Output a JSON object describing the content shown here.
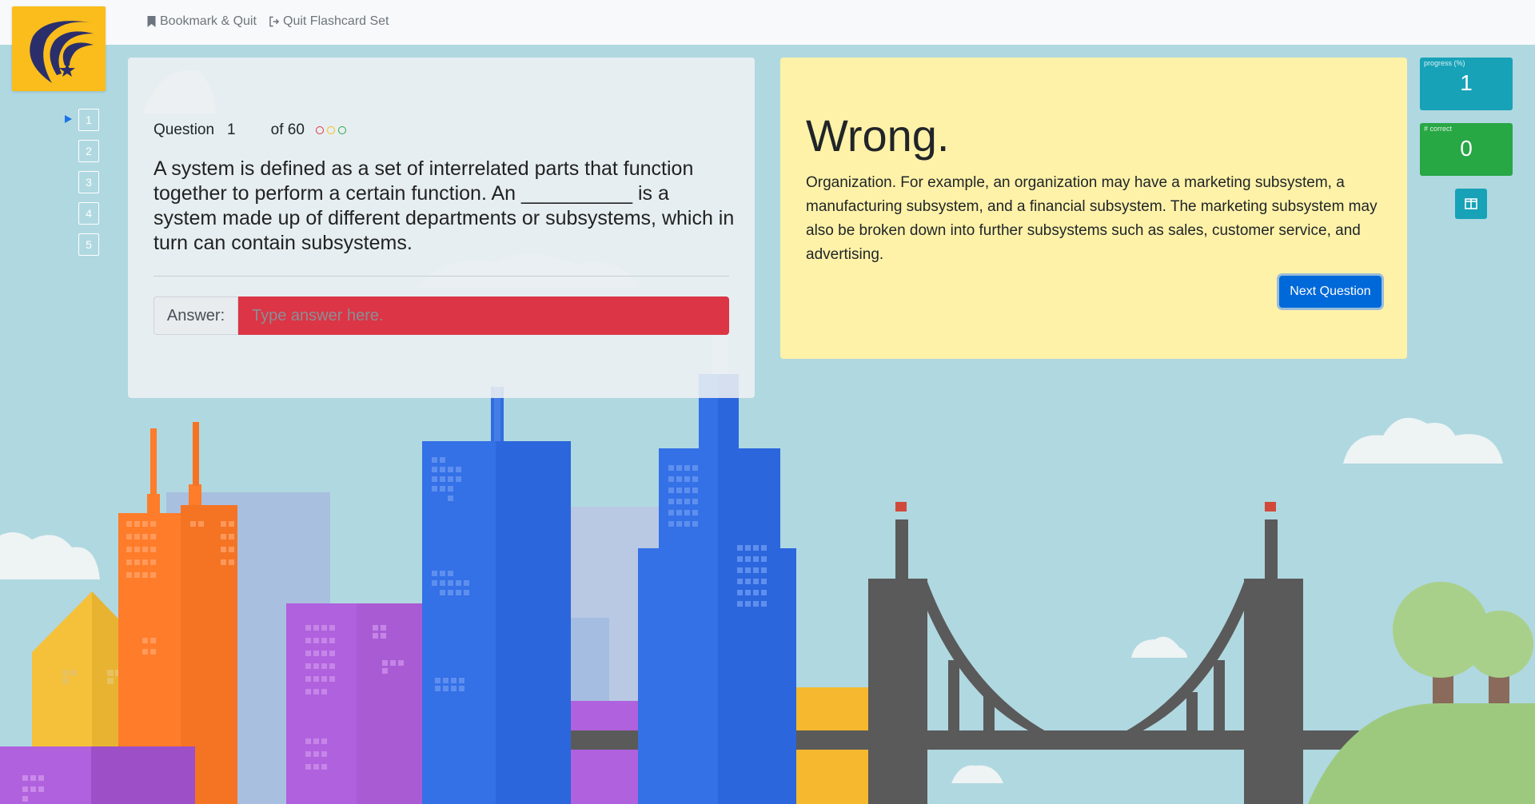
{
  "nav": {
    "bookmark_label": "Bookmark & Quit",
    "quit_label": "Quit Flashcard Set"
  },
  "pager": {
    "items": [
      "1",
      "2",
      "3",
      "4",
      "5"
    ],
    "current_index": 0
  },
  "question": {
    "label": "Question",
    "number": "1",
    "of_total": "of 60",
    "text": "A system is defined as a set of interrelated parts that function together to perform a certain function. An __________ is a system made up of different departments or subsystems, which in turn can contain subsystems.",
    "dot_colors": [
      "#dc3545",
      "#fbbd1c",
      "#28a745"
    ]
  },
  "answer": {
    "label": "Answer:",
    "value": "",
    "placeholder": "Type answer here."
  },
  "feedback": {
    "title": "Wrong.",
    "text": "Organization. For example, an organization may have a marketing subsystem, a manufacturing subsystem, and a financial subsystem. The marketing subsystem may also be broken down into further subsystems such as sales, customer service, and advertising.",
    "next_label": "Next Question"
  },
  "stats": {
    "progress": {
      "label": "progress (%)",
      "value": "1",
      "color": "#17a2b8"
    },
    "correct": {
      "label": "# correct",
      "value": "0",
      "color": "#28a745"
    }
  },
  "colors": {
    "logo_bg": "#fbbd1c",
    "logo_mark": "#2a2f6b",
    "danger": "#dc3545",
    "primary": "#0069d9",
    "feedback_bg": "#fef2a8",
    "sky": "#b0d8e0"
  },
  "icons": {
    "bookmark": "bookmark-icon",
    "quit": "sign-out-icon",
    "layout": "columns-icon",
    "pager_marker": "caret-right-icon"
  }
}
